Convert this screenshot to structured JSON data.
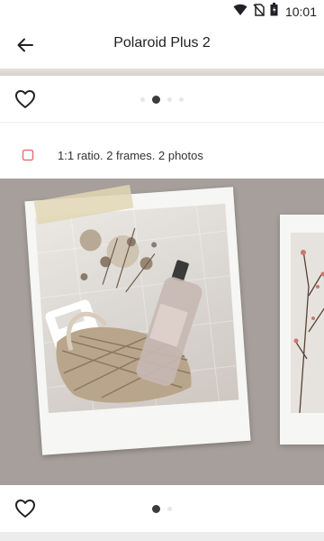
{
  "status_bar": {
    "time": "10:01",
    "icons": [
      "wifi-icon",
      "no-sim-icon",
      "battery-icon"
    ]
  },
  "app_bar": {
    "title": "Polaroid Plus 2",
    "back_icon": "arrow-back-icon"
  },
  "cards": [
    {
      "like_icon": "heart-outline-icon",
      "pager": {
        "count": 4,
        "active_index": 1
      }
    },
    {
      "like_icon": "heart-outline-icon",
      "pager": {
        "count": 2,
        "active_index": 0
      }
    }
  ],
  "info": {
    "icon": "frame-square-icon",
    "text": "1:1 ratio. 2 frames. 2 photos",
    "icon_color": "#e8707a"
  },
  "preview": {
    "background_color": "#a69f9b",
    "frame_color": "#f6f6f4"
  }
}
